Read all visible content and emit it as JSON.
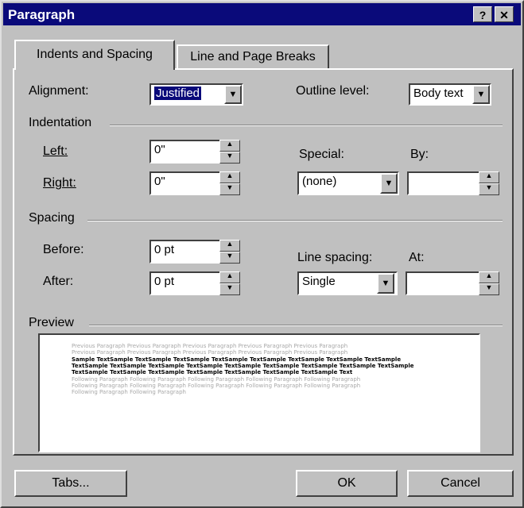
{
  "window": {
    "title": "Paragraph",
    "help_label": "?",
    "close_label": "✕"
  },
  "tabs": [
    {
      "label": "Indents and Spacing",
      "active": true
    },
    {
      "label": "Line and Page Breaks",
      "active": false
    }
  ],
  "alignment": {
    "label": "Alignment:",
    "value": "Justified"
  },
  "outline_level": {
    "label": "Outline level:",
    "value": "Body text"
  },
  "indentation": {
    "group_label": "Indentation",
    "left": {
      "label": "Left:",
      "value": "0\""
    },
    "right": {
      "label": "Right:",
      "value": "0\""
    },
    "special": {
      "label": "Special:",
      "value": "(none)"
    },
    "by": {
      "label": "By:",
      "value": ""
    }
  },
  "spacing": {
    "group_label": "Spacing",
    "before": {
      "label": "Before:",
      "value": "0 pt"
    },
    "after": {
      "label": "After:",
      "value": "0 pt"
    },
    "line_spacing": {
      "label": "Line spacing:",
      "value": "Single"
    },
    "at": {
      "label": "At:",
      "value": ""
    }
  },
  "preview": {
    "group_label": "Preview",
    "lines": [
      {
        "text": "Previous Paragraph Previous Paragraph Previous Paragraph Previous Paragraph Previous Paragraph",
        "style": "grey"
      },
      {
        "text": "Previous Paragraph Previous Paragraph Previous Paragraph Previous Paragraph Previous Paragraph",
        "style": "grey"
      },
      {
        "text": "Sample TextSample TextSample TextSample TextSample TextSample TextSample TextSample TextSample",
        "style": "black"
      },
      {
        "text": "TextSample TextSample TextSample TextSample TextSample TextSample TextSample TextSample TextSample",
        "style": "black"
      },
      {
        "text": "TextSample TextSample TextSample TextSample TextSample TextSample TextSample Text",
        "style": "black"
      },
      {
        "text": "Following Paragraph Following Paragraph Following Paragraph Following Paragraph Following Paragraph",
        "style": "grey"
      },
      {
        "text": "Following Paragraph Following Paragraph Following Paragraph Following Paragraph Following Paragraph",
        "style": "grey"
      },
      {
        "text": "Following Paragraph Following Paragraph",
        "style": "grey"
      }
    ]
  },
  "buttons": {
    "tabs": "Tabs...",
    "ok": "OK",
    "cancel": "Cancel"
  },
  "icons": {
    "spinner": "up-down-arrows",
    "dropdown": "down-triangle"
  }
}
